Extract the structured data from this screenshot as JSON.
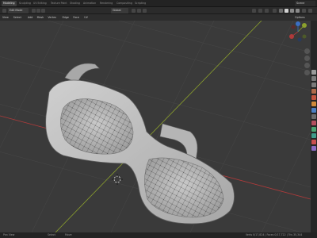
{
  "workspace_tabs": [
    {
      "label": "Modeling",
      "active": true
    },
    {
      "label": "Sculpting",
      "active": false
    },
    {
      "label": "UV Editing",
      "active": false
    },
    {
      "label": "Texture Paint",
      "active": false
    },
    {
      "label": "Shading",
      "active": false
    },
    {
      "label": "Animation",
      "active": false
    },
    {
      "label": "Rendering",
      "active": false
    },
    {
      "label": "Compositing",
      "active": false
    },
    {
      "label": "Scripting",
      "active": false
    }
  ],
  "scene_name": "Scene",
  "header": {
    "mode_label": "Edit Mode",
    "orientation_label": "Global",
    "menus": [
      "View",
      "Select",
      "Add",
      "Mesh",
      "Vertex",
      "Edge",
      "Face",
      "UV"
    ],
    "options_label": "Options"
  },
  "status_bar": {
    "left_text": "Pan View",
    "mid_text": "Select",
    "mid2_text": "Move",
    "right_text": "Verts 0/17,824 | Faces 0/17,722 | Tris 35,344"
  },
  "colors": {
    "viewport_bg": "#3a3a3a",
    "axis_x": "#b03a3a",
    "axis_y": "#8ca12d",
    "mesh_face": "#b8b8b8",
    "active_tab": "#3d3d3d"
  }
}
